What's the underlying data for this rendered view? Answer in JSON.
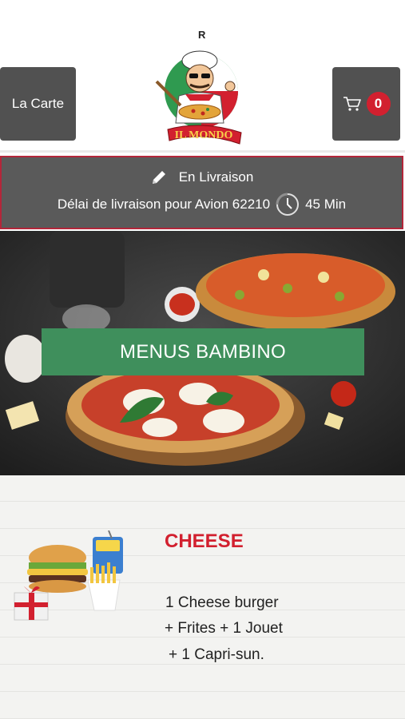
{
  "header": {
    "status_mark": "R",
    "la_carte_label": "La Carte",
    "cart_count": "0",
    "logo_text": "IL MONDO"
  },
  "delivery": {
    "mode": "En Livraison",
    "delay_text": "Délai de livraison pour Avion 62210",
    "time": "45 Min"
  },
  "hero": {
    "banner_label": "MENUS BAMBINO"
  },
  "product": {
    "title": "CHEESE",
    "lines": [
      "1 Cheese burger",
      "+ Frites  + 1 Jouet",
      "+ 1 Capri-sun."
    ]
  },
  "colors": {
    "accent_red": "#d2202f",
    "banner_green": "#3f8f5c",
    "button_gray": "#515151",
    "delivery_gray": "#5a5a5a",
    "delivery_border": "#b3263a"
  },
  "icons": [
    "cart-icon",
    "pencil-icon",
    "clock-icon"
  ]
}
